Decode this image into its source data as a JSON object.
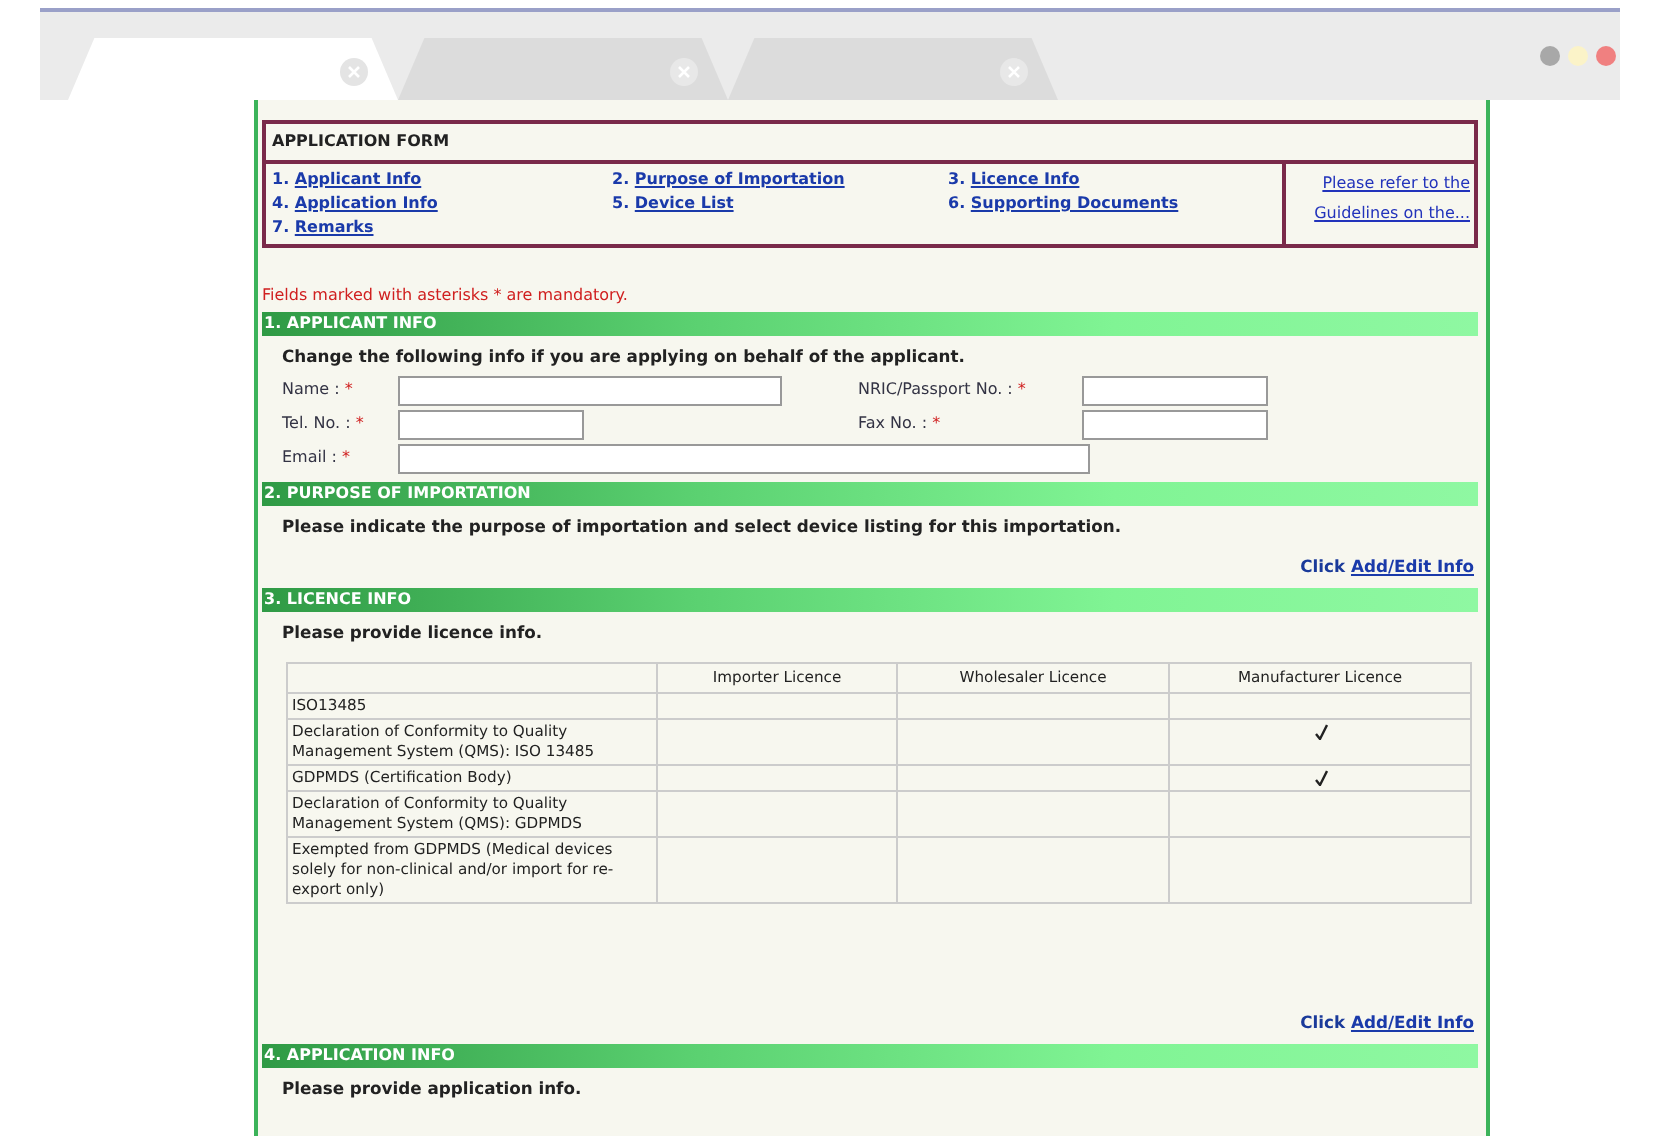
{
  "browser": {
    "tabs": [
      {
        "selected": true
      },
      {
        "selected": false
      },
      {
        "selected": false
      }
    ]
  },
  "form_index": {
    "title": "APPLICATION FORM",
    "links": [
      {
        "number": "1.",
        "label": "Applicant Info"
      },
      {
        "number": "2.",
        "label": "Purpose of Importation"
      },
      {
        "number": "3.",
        "label": "Licence Info"
      },
      {
        "number": "4.",
        "label": "Application Info"
      },
      {
        "number": "5.",
        "label": "Device List"
      },
      {
        "number": "6.",
        "label": "Supporting Documents"
      },
      {
        "number": "7.",
        "label": "Remarks"
      }
    ],
    "note": "Please refer to the Guidelines on the..."
  },
  "mandatory_note": "Fields marked with asterisks * are mandatory.",
  "sections": [
    {
      "kind": "fields",
      "header": "1. APPLICANT INFO",
      "instruction": "Change the following info if you are applying on behalf of the applicant.",
      "fields": [
        {
          "label": "Name :",
          "mark": "*"
        },
        {
          "label": "NRIC/Passport No. :",
          "mark": "*"
        },
        {
          "label": "Tel. No. :",
          "mark": "*"
        },
        {
          "label": "Fax No. :",
          "mark": "*"
        },
        {
          "label": "Email :",
          "mark": "*"
        }
      ]
    },
    {
      "kind": "text",
      "header": "2. PURPOSE OF IMPORTATION",
      "instruction": "Please indicate the purpose of importation and select device listing for this importation.",
      "link": {
        "prefix": "Click",
        "label": "Add/Edit Info"
      }
    },
    {
      "kind": "table",
      "header": "3. LICENCE INFO",
      "instruction": "Please provide licence info.",
      "table": {
        "columns": [
          "Importer Licence",
          "Wholesaler Licence",
          "Manufacturer Licence"
        ],
        "rows": [
          {
            "label": "ISO13485",
            "checked": [
              false,
              false,
              false
            ]
          },
          {
            "label": "Declaration of Conformity to Quality Management System (QMS): ISO 13485",
            "checked": [
              false,
              false,
              true
            ]
          },
          {
            "label": "GDPMDS (Certification Body)",
            "checked": [
              false,
              false,
              true
            ]
          },
          {
            "label": "Declaration of Conformity to Quality Management System (QMS): GDPMDS",
            "checked": [
              false,
              false,
              false
            ]
          },
          {
            "label": "Exempted from GDPMDS (Medical devices solely for non-clinical and/or import for re-export only)",
            "checked": [
              false,
              false,
              false
            ]
          }
        ]
      },
      "link": {
        "prefix": "Click",
        "label": "Add/Edit Info"
      }
    },
    {
      "kind": "text",
      "header": "4. APPLICATION INFO",
      "instruction": "Please provide application info."
    }
  ]
}
